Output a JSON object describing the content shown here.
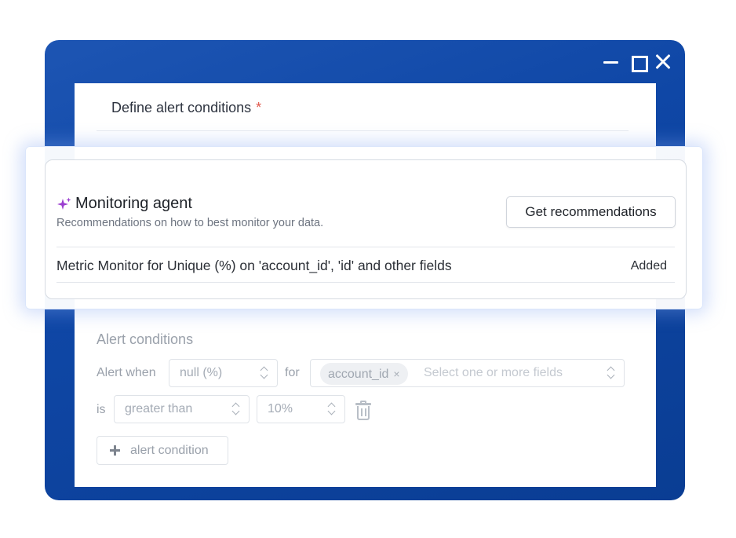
{
  "window": {
    "controls": [
      "minimize-icon",
      "maximize-icon",
      "close-icon"
    ]
  },
  "form": {
    "title": "Define alert conditions",
    "required_marker": "*"
  },
  "agent": {
    "icon": "sparkle-icon",
    "title": "Monitoring agent",
    "subtitle": "Recommendations on how to best monitor your data.",
    "button_label": "Get recommendations",
    "recommendation": {
      "text": "Metric Monitor for Unique (%) on 'account_id', 'id' and other fields",
      "status": "Added"
    }
  },
  "alert": {
    "title": "Alert conditions",
    "alert_when_label": "Alert when",
    "metric_value": "null (%)",
    "for_label": "for",
    "field_chip": "account_id",
    "field_chip_remove": "×",
    "fields_placeholder": "Select one or more fields",
    "is_label": "is",
    "operator_value": "greater than",
    "threshold_value": "10%",
    "delete_icon": "trash-icon",
    "add_condition_label": "alert condition",
    "add_icon": "plus-icon"
  },
  "colors": {
    "window_bg": "#0f47a6",
    "accent_glow": "#80a4f0",
    "sparkle": "#9b3fd0",
    "required": "#e0564a"
  }
}
